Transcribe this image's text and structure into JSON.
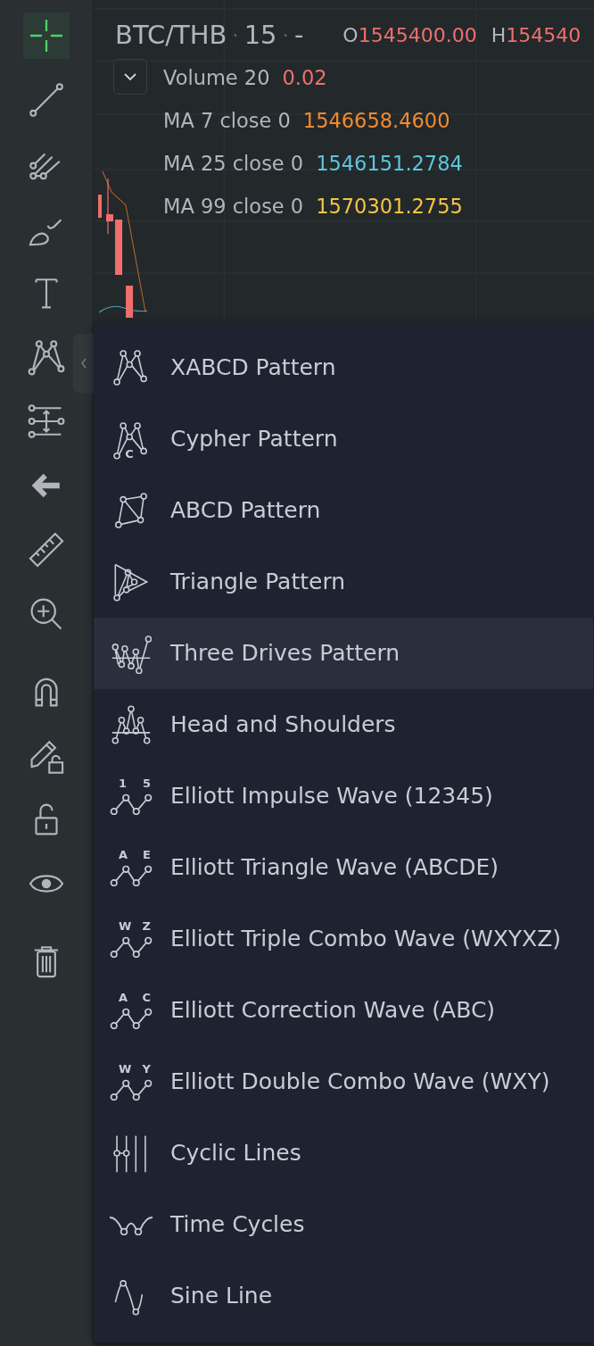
{
  "header": {
    "parts": [
      "BTC/THB",
      "15",
      "-"
    ],
    "separator": "·",
    "ohlc": [
      {
        "label": "O",
        "value": "1545400.00"
      },
      {
        "label": "H",
        "value": "154540"
      }
    ]
  },
  "legend": {
    "expanded": true,
    "rows": [
      {
        "name": "Volume 20",
        "value": "0.02",
        "color": "#ef6f6c"
      },
      {
        "name": "MA 7 close 0",
        "value": "1546658.4600",
        "color": "#f28a2e"
      },
      {
        "name": "MA 25 close 0",
        "value": "1546151.2784",
        "color": "#5cc6dc"
      },
      {
        "name": "MA 99 close 0",
        "value": "1570301.2755",
        "color": "#f5c542"
      }
    ]
  },
  "sidebar": {
    "groups": [
      [
        {
          "kind": "crosshair",
          "selected": true
        },
        {
          "kind": "trendline",
          "selected": false
        },
        {
          "kind": "pitchfork",
          "selected": false
        },
        {
          "kind": "brush",
          "selected": false
        },
        {
          "kind": "text",
          "selected": false
        },
        {
          "kind": "pattern",
          "selected": false
        },
        {
          "kind": "projection",
          "selected": false
        },
        {
          "kind": "back",
          "selected": false
        },
        {
          "kind": "ruler",
          "selected": false
        },
        {
          "kind": "zoom",
          "selected": false
        }
      ],
      [
        {
          "kind": "magnet",
          "selected": false
        },
        {
          "kind": "pencil-lock",
          "selected": false
        },
        {
          "kind": "lock",
          "selected": false
        },
        {
          "kind": "eye",
          "selected": false
        }
      ],
      [
        {
          "kind": "trash",
          "selected": false
        }
      ]
    ]
  },
  "menu": {
    "items": [
      {
        "label": "XABCD Pattern",
        "kind": "xabcd",
        "selected": false
      },
      {
        "label": "Cypher Pattern",
        "kind": "cypher",
        "selected": false,
        "marks": [
          "C"
        ]
      },
      {
        "label": "ABCD Pattern",
        "kind": "abcd",
        "selected": false
      },
      {
        "label": "Triangle Pattern",
        "kind": "triangle",
        "selected": false
      },
      {
        "label": "Three Drives Pattern",
        "kind": "drives",
        "selected": true
      },
      {
        "label": "Head and Shoulders",
        "kind": "head",
        "selected": false
      },
      {
        "label": "Elliott Impulse Wave (12345)",
        "kind": "wave",
        "selected": false,
        "marks": [
          "1",
          "5"
        ]
      },
      {
        "label": "Elliott Triangle Wave (ABCDE)",
        "kind": "wave",
        "selected": false,
        "marks": [
          "A",
          "E"
        ]
      },
      {
        "label": "Elliott Triple Combo Wave (WXYXZ)",
        "kind": "wave",
        "selected": false,
        "marks": [
          "W",
          "Z"
        ]
      },
      {
        "label": "Elliott Correction Wave (ABC)",
        "kind": "wave",
        "selected": false,
        "marks": [
          "A",
          "C"
        ]
      },
      {
        "label": "Elliott Double Combo Wave (WXY)",
        "kind": "wave",
        "selected": false,
        "marks": [
          "W",
          "Y"
        ]
      },
      {
        "label": "Cyclic Lines",
        "kind": "cyclic",
        "selected": false
      },
      {
        "label": "Time Cycles",
        "kind": "cycles",
        "selected": false
      },
      {
        "label": "Sine Line",
        "kind": "sine",
        "selected": false
      }
    ]
  }
}
